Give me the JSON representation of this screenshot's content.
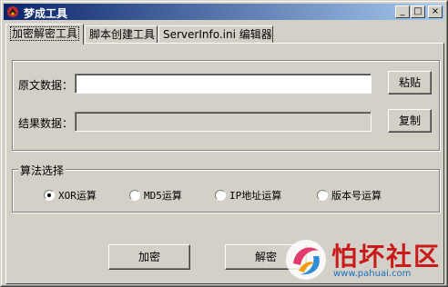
{
  "window": {
    "title": "梦成工具",
    "controls": {
      "minimize": "_",
      "maximize": "□",
      "close": "×"
    }
  },
  "tabs": [
    {
      "label": "加密解密工具",
      "active": true
    },
    {
      "label": "脚本创建工具",
      "active": false
    },
    {
      "label": "ServerInfo.ini 编辑器",
      "active": false
    }
  ],
  "data_section": {
    "source_label": "原文数据：",
    "source_value": "",
    "paste_button": "粘贴",
    "result_label": "结果数据：",
    "result_value": "",
    "copy_button": "复制"
  },
  "algorithm": {
    "legend": "算法选择",
    "options": [
      {
        "label": "XOR运算",
        "checked": true
      },
      {
        "label": "MD5运算",
        "checked": false
      },
      {
        "label": "IP地址运算",
        "checked": false
      },
      {
        "label": "版本号运算",
        "checked": false
      }
    ]
  },
  "actions": {
    "encrypt_button": "加密",
    "decrypt_button": "解密"
  },
  "watermark": {
    "text": "怕坏社区",
    "url": "www.pahuai.com"
  },
  "colors": {
    "face": "#d4d0c8",
    "titlebar_start": "#0a246a",
    "titlebar_end": "#a6caf0",
    "watermark_red": "#c81a1a",
    "watermark_blue": "#1a6fc0"
  }
}
